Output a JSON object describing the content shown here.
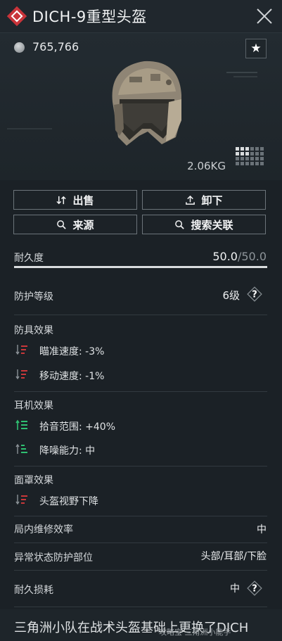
{
  "header": {
    "title": "DICH-9重型头盔"
  },
  "hero": {
    "price": "765,766",
    "weight": "2.06KG"
  },
  "actions": {
    "sell": "出售",
    "unequip": "卸下",
    "source": "来源",
    "search_related": "搜索关联"
  },
  "durability": {
    "label": "耐久度",
    "current": "50.0",
    "max": "/50.0",
    "fraction": 1.0
  },
  "protection": {
    "label": "防护等级",
    "value": "6级"
  },
  "armor_effects": {
    "title": "防具效果",
    "items": [
      {
        "text": "瞄准速度: -3%",
        "kind": "negative"
      },
      {
        "text": "移动速度: -1%",
        "kind": "negative"
      }
    ]
  },
  "headset_effects": {
    "title": "耳机效果",
    "items": [
      {
        "text": "拾音范围: +40%",
        "kind": "positive-strong"
      },
      {
        "text": "降噪能力: 中",
        "kind": "positive"
      }
    ]
  },
  "mask_effects": {
    "title": "面罩效果",
    "items": [
      {
        "text": "头盔视野下降",
        "kind": "negative"
      }
    ]
  },
  "repair": {
    "label": "局内维修效率",
    "value": "中"
  },
  "status_protection": {
    "label": "异常状态防护部位",
    "value": "头部/耳部/下脸"
  },
  "wear": {
    "label": "耐久损耗",
    "value": "中"
  },
  "description": "三角洲小队在战术头盔基础上更换了DICH",
  "watermark": "攻略宝 三角洲小能手",
  "colors": {
    "negative": "#c8383a",
    "positive": "#2fbf71",
    "accent": "#e0464b"
  },
  "icons": {
    "rarity": "diamond-rarity-icon",
    "close": "close-icon",
    "favorite": "star-icon",
    "sell": "swap-icon",
    "unequip": "upload-icon",
    "search": "search-icon",
    "help": "question-icon"
  }
}
